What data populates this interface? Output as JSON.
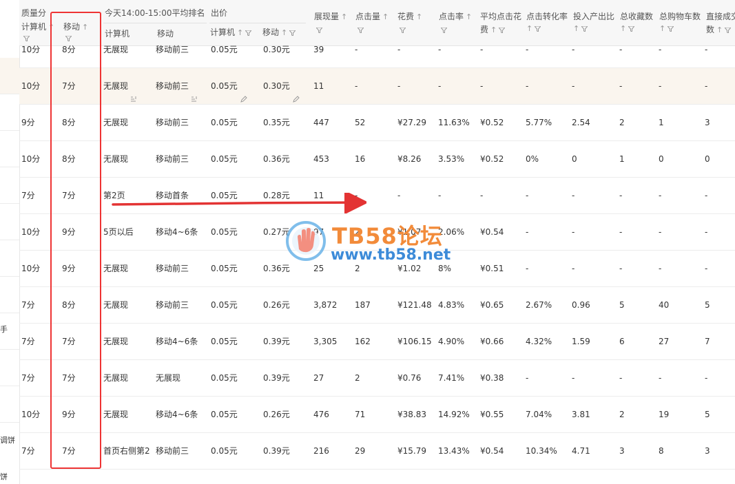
{
  "left_strip": {
    "labels": [
      "手",
      "调饼",
      "饼"
    ]
  },
  "header": {
    "quality_score": "质量分",
    "pc": "计算机",
    "mobile": "移动",
    "avg_rank_group": "今天14:00-15:00平均排名",
    "rank_pc": "计算机",
    "rank_mobile": "移动",
    "bid_group": "出价",
    "bid_pc": "计算机",
    "bid_mobile": "移动",
    "impressions": "展现量",
    "clicks": "点击量",
    "cost": "花费",
    "ctr": "点击率",
    "avg_cpc_line1": "平均点击花",
    "avg_cpc_line2": "费",
    "cvr": "点击转化率",
    "roi": "投入产出比",
    "favorites": "总收藏数",
    "cart": "总购物车数",
    "direct_line1": "直接成交",
    "direct_line2": "数",
    "sort_arrow": "↑"
  },
  "rows": [
    {
      "qs_pc": "10分",
      "qs_m": "8分",
      "rank_pc": "无展现",
      "rank_m": "移动前三",
      "bid_pc": "0.05元",
      "bid_m": "0.30元",
      "imp": "39",
      "clk": "-",
      "cost": "-",
      "ctr": "-",
      "cpc": "-",
      "cvr": "-",
      "roi": "-",
      "fav": "-",
      "cart": "-",
      "direct": "-"
    },
    {
      "qs_pc": "10分",
      "qs_m": "7分",
      "rank_pc": "无展现",
      "rank_m": "移动前三",
      "bid_pc": "0.05元",
      "bid_m": "0.30元",
      "imp": "11",
      "clk": "-",
      "cost": "-",
      "ctr": "-",
      "cpc": "-",
      "cvr": "-",
      "roi": "-",
      "fav": "-",
      "cart": "-",
      "direct": "-"
    },
    {
      "qs_pc": "9分",
      "qs_m": "8分",
      "rank_pc": "无展现",
      "rank_m": "移动前三",
      "bid_pc": "0.05元",
      "bid_m": "0.35元",
      "imp": "447",
      "clk": "52",
      "cost": "¥27.29",
      "ctr": "11.63%",
      "cpc": "¥0.52",
      "cvr": "5.77%",
      "roi": "2.54",
      "fav": "2",
      "cart": "1",
      "direct": "3"
    },
    {
      "qs_pc": "10分",
      "qs_m": "8分",
      "rank_pc": "无展现",
      "rank_m": "移动前三",
      "bid_pc": "0.05元",
      "bid_m": "0.36元",
      "imp": "453",
      "clk": "16",
      "cost": "¥8.26",
      "ctr": "3.53%",
      "cpc": "¥0.52",
      "cvr": "0%",
      "roi": "0",
      "fav": "1",
      "cart": "0",
      "direct": "0"
    },
    {
      "qs_pc": "7分",
      "qs_m": "7分",
      "rank_pc": "第2页",
      "rank_m": "移动首条",
      "bid_pc": "0.05元",
      "bid_m": "0.28元",
      "imp": "11",
      "clk": "-",
      "cost": "-",
      "ctr": "-",
      "cpc": "-",
      "cvr": "-",
      "roi": "-",
      "fav": "-",
      "cart": "-",
      "direct": "-"
    },
    {
      "qs_pc": "10分",
      "qs_m": "9分",
      "rank_pc": "5页以后",
      "rank_m": "移动4~6条",
      "bid_pc": "0.05元",
      "bid_m": "0.27元",
      "imp": "97",
      "clk": "2",
      "cost": "¥1.07",
      "ctr": "2.06%",
      "cpc": "¥0.54",
      "cvr": "-",
      "roi": "-",
      "fav": "-",
      "cart": "-",
      "direct": "-"
    },
    {
      "qs_pc": "10分",
      "qs_m": "9分",
      "rank_pc": "无展现",
      "rank_m": "移动前三",
      "bid_pc": "0.05元",
      "bid_m": "0.36元",
      "imp": "25",
      "clk": "2",
      "cost": "¥1.02",
      "ctr": "8%",
      "cpc": "¥0.51",
      "cvr": "-",
      "roi": "-",
      "fav": "-",
      "cart": "-",
      "direct": "-"
    },
    {
      "qs_pc": "7分",
      "qs_m": "8分",
      "rank_pc": "无展现",
      "rank_m": "移动前三",
      "bid_pc": "0.05元",
      "bid_m": "0.26元",
      "imp": "3,872",
      "clk": "187",
      "cost": "¥121.48",
      "ctr": "4.83%",
      "cpc": "¥0.65",
      "cvr": "2.67%",
      "roi": "0.96",
      "fav": "5",
      "cart": "40",
      "direct": "5"
    },
    {
      "qs_pc": "7分",
      "qs_m": "7分",
      "rank_pc": "无展现",
      "rank_m": "移动4~6条",
      "bid_pc": "0.05元",
      "bid_m": "0.39元",
      "imp": "3,305",
      "clk": "162",
      "cost": "¥106.15",
      "ctr": "4.90%",
      "cpc": "¥0.66",
      "cvr": "4.32%",
      "roi": "1.59",
      "fav": "6",
      "cart": "27",
      "direct": "7"
    },
    {
      "qs_pc": "7分",
      "qs_m": "7分",
      "rank_pc": "无展现",
      "rank_m": "无展现",
      "bid_pc": "0.05元",
      "bid_m": "0.39元",
      "imp": "27",
      "clk": "2",
      "cost": "¥0.76",
      "ctr": "7.41%",
      "cpc": "¥0.38",
      "cvr": "-",
      "roi": "-",
      "fav": "-",
      "cart": "-",
      "direct": "-"
    },
    {
      "qs_pc": "10分",
      "qs_m": "9分",
      "rank_pc": "无展现",
      "rank_m": "移动4~6条",
      "bid_pc": "0.05元",
      "bid_m": "0.26元",
      "imp": "476",
      "clk": "71",
      "cost": "¥38.83",
      "ctr": "14.92%",
      "cpc": "¥0.55",
      "cvr": "7.04%",
      "roi": "3.81",
      "fav": "2",
      "cart": "19",
      "direct": "5"
    },
    {
      "qs_pc": "7分",
      "qs_m": "7分",
      "rank_pc": "首页右侧第2",
      "rank_m": "移动前三",
      "bid_pc": "0.05元",
      "bid_m": "0.39元",
      "imp": "216",
      "clk": "29",
      "cost": "¥15.79",
      "ctr": "13.43%",
      "cpc": "¥0.54",
      "cvr": "10.34%",
      "roi": "4.71",
      "fav": "3",
      "cart": "8",
      "direct": "3"
    }
  ],
  "watermark": {
    "title": "TB58论坛",
    "url": "www.tb58.net"
  },
  "colors": {
    "highlight_row": "#faf5ee",
    "annotation_red": "#e33333",
    "watermark_orange": "#f28b3a",
    "watermark_blue": "#3d8bd8"
  }
}
